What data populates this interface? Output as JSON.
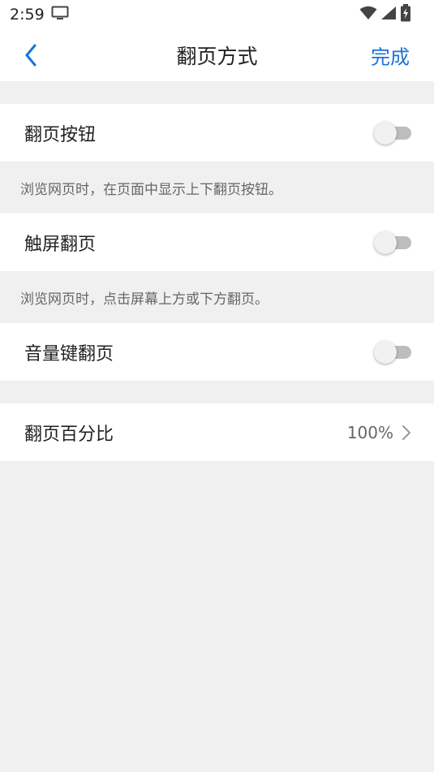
{
  "status_bar": {
    "time": "2:59"
  },
  "nav": {
    "title": "翻页方式",
    "done_label": "完成"
  },
  "settings": {
    "page_button": {
      "label": "翻页按钮",
      "enabled": false,
      "description": "浏览网页时，在页面中显示上下翻页按钮。"
    },
    "touch_page": {
      "label": "触屏翻页",
      "enabled": false,
      "description": "浏览网页时，点击屏幕上方或下方翻页。"
    },
    "volume_key_page": {
      "label": "音量键翻页",
      "enabled": false
    },
    "page_percent": {
      "label": "翻页百分比",
      "value": "100%"
    }
  },
  "colors": {
    "accent": "#1a73d9",
    "background": "#f0f0f0",
    "card": "#ffffff"
  }
}
